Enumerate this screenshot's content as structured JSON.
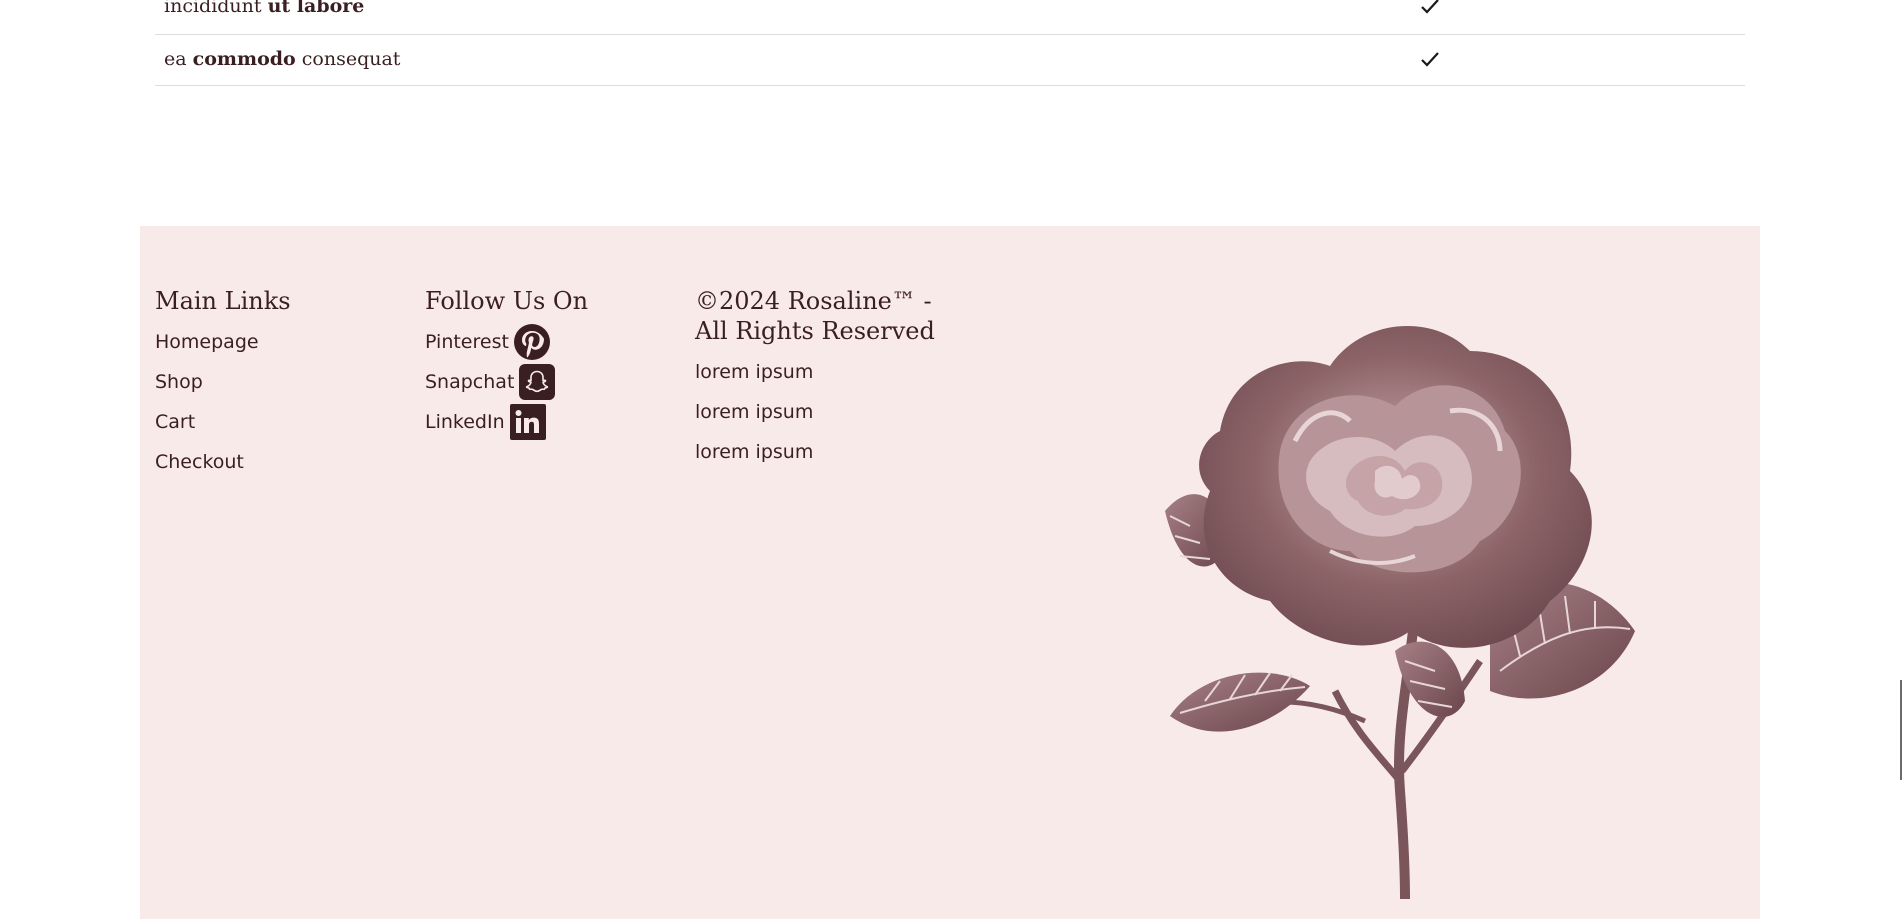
{
  "table": {
    "rows": [
      {
        "pre": "incididunt ",
        "bold": "ut labore",
        "post": "",
        "checked": true
      },
      {
        "pre": "ea ",
        "bold": "commodo",
        "post": " consequat",
        "checked": true
      }
    ]
  },
  "footer": {
    "main_links": {
      "heading": "Main Links",
      "items": [
        "Homepage",
        "Shop",
        "Cart",
        "Checkout"
      ]
    },
    "follow": {
      "heading": "Follow Us On",
      "items": [
        {
          "label": "Pinterest",
          "icon": "pinterest-icon"
        },
        {
          "label": "Snapchat",
          "icon": "snapchat-icon"
        },
        {
          "label": "LinkedIn",
          "icon": "linkedin-icon"
        }
      ]
    },
    "copyright": {
      "line1": "©2024 Rosaline™ -",
      "line2": "All Rights Reserved",
      "items": [
        "lorem ipsum",
        "lorem ipsum",
        "lorem ipsum"
      ]
    },
    "colors": {
      "background": "#f9eaea",
      "text": "#3a1f22",
      "icon": "#3a1f22"
    },
    "rose_image": "rose-illustration"
  }
}
